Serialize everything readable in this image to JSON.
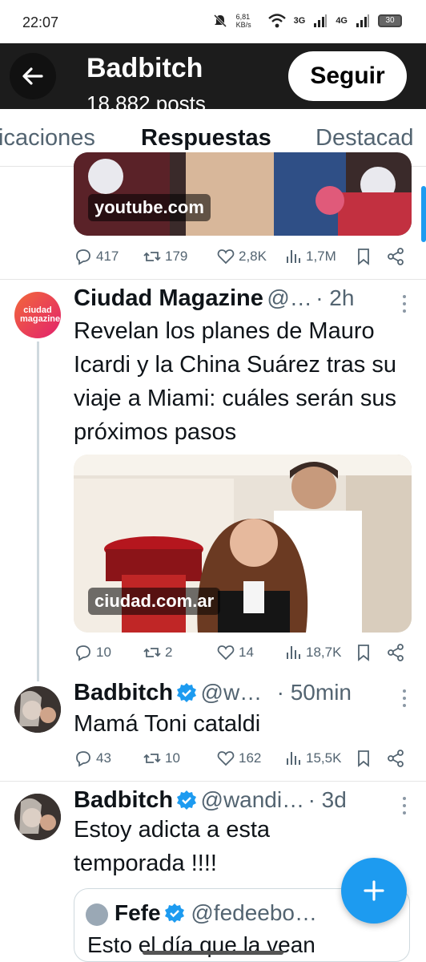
{
  "status_bar": {
    "time": "22:07",
    "speed": "6,81 KB/s",
    "signal_a": "3G",
    "signal_b": "4G",
    "battery": "30"
  },
  "header": {
    "name": "Badbitch",
    "posts": "18.882 posts",
    "follow_label": "Seguir"
  },
  "tabs": [
    {
      "label": "Publicaciones",
      "visible": "icaciones"
    },
    {
      "label": "Respuestas",
      "active": true
    },
    {
      "label": "Destacados",
      "visible": "Destacad"
    }
  ],
  "post0": {
    "link_label": "youtube.com",
    "replies": "417",
    "reposts": "179",
    "likes": "2,8K",
    "views": "1,7M"
  },
  "post1": {
    "avatar_text": "ciudad magazine",
    "author": "Ciudad Magazine",
    "handle": "@…",
    "time": "· 2h",
    "text": "Revelan los planes de Mauro Icardi y la China Suárez tras su viaje a Miami: cuáles serán sus próximos pasos",
    "link_label": "ciudad.com.ar",
    "replies": "10",
    "reposts": "2",
    "likes": "14",
    "views": "18,7K"
  },
  "post2": {
    "author": "Badbitch",
    "handle": "@w…",
    "time": "· 50min",
    "text": "Mamá Toni cataldi",
    "replies": "43",
    "reposts": "10",
    "likes": "162",
    "views": "15,5K"
  },
  "post3": {
    "author": "Badbitch",
    "handle": "@wandi…",
    "time": "· 3d",
    "text": "Estoy adicta a esta temporada !!!!",
    "quote_author": "Fefe",
    "quote_handle": "@fedeebo…",
    "quote_text": "Esto el día que la vean"
  },
  "colors": {
    "accent": "#1d9bf0",
    "header_bg": "#1c1c1c",
    "muted": "#536471"
  },
  "icons": [
    "back-arrow-icon",
    "reply-icon",
    "repost-icon",
    "like-icon",
    "views-icon",
    "bookmark-icon",
    "share-icon",
    "verified-icon",
    "more-icon",
    "plus-icon"
  ]
}
